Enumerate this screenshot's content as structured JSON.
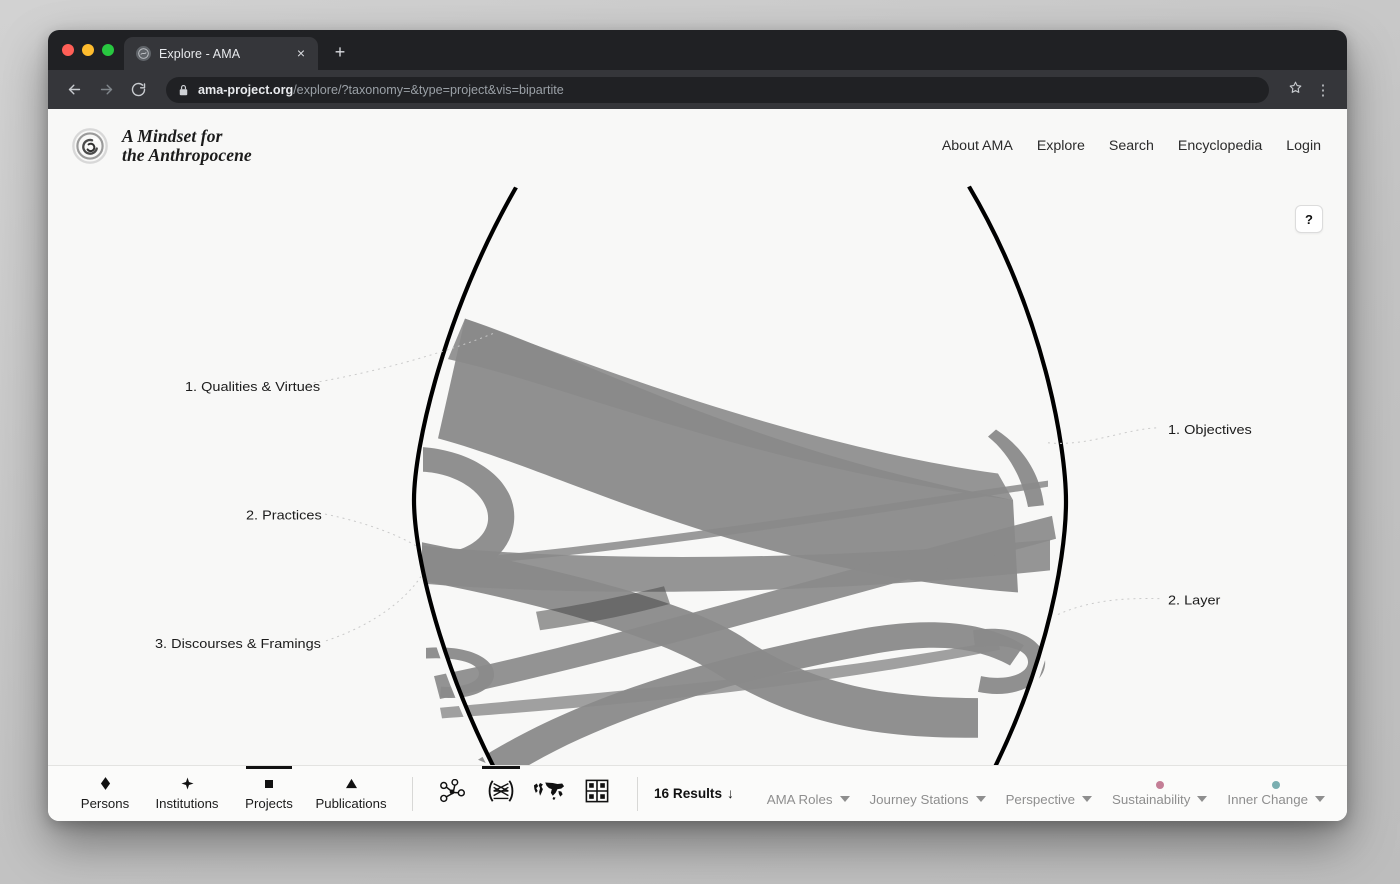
{
  "browser": {
    "tab": {
      "title": "Explore - AMA",
      "favicon": "globe-icon",
      "close": "×"
    },
    "newtab_label": "+",
    "back_label": "←",
    "forward_label": "→",
    "reload_label": "⟳",
    "url_host": "ama-project.org",
    "url_path": "/explore/?taxonomy=&type=project&vis=bipartite",
    "star_label": "☆",
    "menu_label": "⋮"
  },
  "site": {
    "brand_line1": "A Mindset for",
    "brand_line2": "the Anthropocene",
    "nav": [
      {
        "label": "About AMA"
      },
      {
        "label": "Explore"
      },
      {
        "label": "Search"
      },
      {
        "label": "Encyclopedia"
      },
      {
        "label": "Login"
      }
    ],
    "help_label": "?"
  },
  "chart_data": {
    "type": "bipartite-chord",
    "title": "",
    "left_axis_label": "",
    "right_axis_label": "",
    "left_groups": [
      {
        "id": "L1",
        "label": "1. Qualities & Virtues"
      },
      {
        "id": "L2",
        "label": "2. Practices"
      },
      {
        "id": "L3",
        "label": "3. Discourses & Framings"
      }
    ],
    "right_groups": [
      {
        "id": "R1",
        "label": "1. Objectives"
      },
      {
        "id": "R2",
        "label": "2. Layer"
      }
    ],
    "links": [
      {
        "source": "L1",
        "target": "R1",
        "value": 4
      },
      {
        "source": "L1",
        "target": "R2",
        "value": 9
      },
      {
        "source": "L2",
        "target": "R1",
        "value": 3
      },
      {
        "source": "L2",
        "target": "R2",
        "value": 8
      },
      {
        "source": "L3",
        "target": "R1",
        "value": 2
      },
      {
        "source": "L3",
        "target": "R2",
        "value": 7
      }
    ],
    "ribbon_color": "#8a8a8a",
    "arc_color": "#000000",
    "leader_line_color": "#c9c9c9"
  },
  "bottombar": {
    "entity_types": [
      {
        "label": "Persons",
        "icon": "diamond-icon",
        "active": false
      },
      {
        "label": "Institutions",
        "icon": "cross-icon",
        "active": false
      },
      {
        "label": "Projects",
        "icon": "square-icon",
        "active": true
      },
      {
        "label": "Publications",
        "icon": "triangle-icon",
        "active": false
      }
    ],
    "vis_modes": [
      {
        "name": "network-graph",
        "active": false
      },
      {
        "name": "bipartite-diagram",
        "active": true
      },
      {
        "name": "world-map",
        "active": false
      },
      {
        "name": "grid-table",
        "active": false
      }
    ],
    "results_label": "16 Results",
    "results_sort_icon": "↓",
    "filters": [
      {
        "label": "AMA Roles",
        "dot_color": null
      },
      {
        "label": "Journey Stations",
        "dot_color": null
      },
      {
        "label": "Perspective",
        "dot_color": null
      },
      {
        "label": "Sustainability",
        "dot_color": "#c47e96"
      },
      {
        "label": "Inner Change",
        "dot_color": "#7aaeb0"
      }
    ]
  }
}
